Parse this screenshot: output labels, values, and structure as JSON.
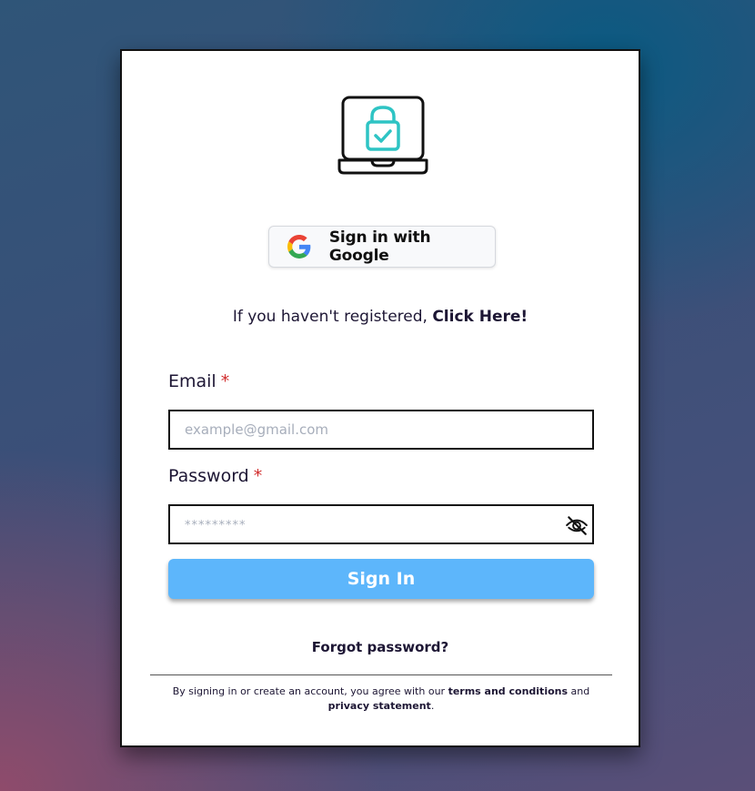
{
  "logo": {
    "icon": "laptop-lock-icon",
    "accent": "#2ec4c4"
  },
  "google_button": {
    "label": "Sign in with Google",
    "icon": "google-icon"
  },
  "register": {
    "prefix": "If you haven't registered, ",
    "link": "Click Here!"
  },
  "email": {
    "label": "Email",
    "required_mark": "*",
    "placeholder": "example@gmail.com",
    "value": ""
  },
  "password": {
    "label": "Password",
    "required_mark": "*",
    "placeholder": "*********",
    "value": "",
    "toggle_icon": "eye-off-icon"
  },
  "signin_button": {
    "label": "Sign In",
    "color": "#5db6fb"
  },
  "forgot_link": "Forgot password?",
  "legal": {
    "prefix": "By signing in or create an account, you agree with our ",
    "terms": "terms and conditions",
    "middle": " and ",
    "privacy": "privacy statement",
    "suffix": "."
  }
}
